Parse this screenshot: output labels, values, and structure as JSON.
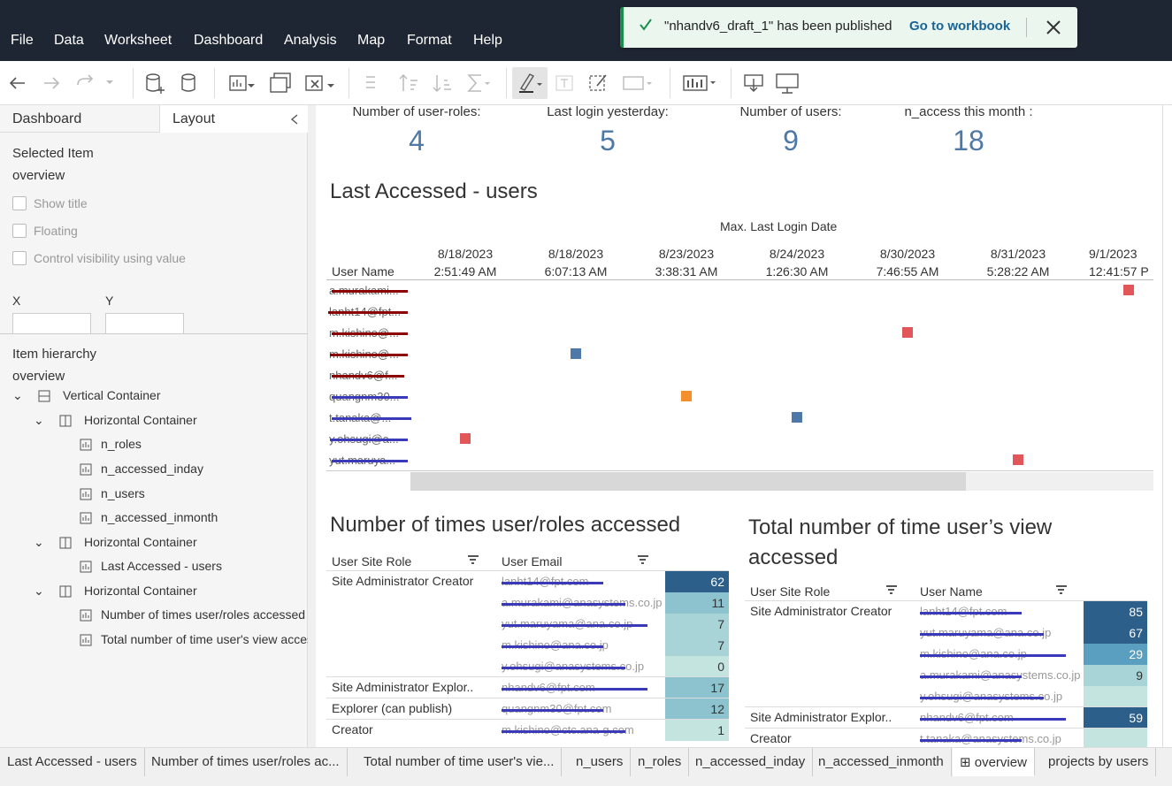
{
  "menu": [
    "File",
    "Data",
    "Worksheet",
    "Dashboard",
    "Analysis",
    "Map",
    "Format",
    "Help"
  ],
  "toast": {
    "message": "\"nhandv6_draft_1\" has been published",
    "link": "Go to workbook"
  },
  "left_pane": {
    "tabs": [
      "Dashboard",
      "Layout"
    ],
    "selected_item_label": "Selected Item",
    "selected_item": "overview",
    "options": [
      "Show title",
      "Floating",
      "Control visibility using value"
    ],
    "x_label": "X",
    "y_label": "Y",
    "hierarchy_label": "Item hierarchy",
    "hierarchy_root": "overview",
    "hierarchy": [
      "Vertical Container",
      "Horizontal Container",
      "n_roles",
      "n_accessed_inday",
      "n_users",
      "n_accessed_inmonth",
      "Horizontal Container",
      "Last Accessed - users",
      "Horizontal Container",
      "Number of times user/roles accessed",
      "Total number of time user's view accessed"
    ]
  },
  "kpis": [
    {
      "label": "Number of user-roles:",
      "value": "4"
    },
    {
      "label": "Last login yesterday:",
      "value": "5"
    },
    {
      "label": "Number of users:",
      "value": "9"
    },
    {
      "label": "n_access this month :",
      "value": "18"
    }
  ],
  "chart1": {
    "title": "Last Accessed - users",
    "header": "Max. Last Login Date",
    "row_header": "User Name",
    "columns": [
      [
        "8/18/2023",
        "2:51:49 AM"
      ],
      [
        "8/18/2023",
        "6:07:13 AM"
      ],
      [
        "8/23/2023",
        "3:38:31 AM"
      ],
      [
        "8/24/2023",
        "1:26:30 AM"
      ],
      [
        "8/30/2023",
        "7:46:55 AM"
      ],
      [
        "8/31/2023",
        "5:28:22 AM"
      ],
      [
        "9/1/2023",
        "12:41:57 P"
      ]
    ],
    "rows": [
      "a.murakami...",
      "lanht14@fpt...",
      "m.kishino@...",
      "m.kishino@...",
      "nhandv6@f...",
      "quangnm30...",
      "t.tanaka@...",
      "y.ohsugi@a...",
      "yut.maruya..."
    ],
    "colors": {
      "red": "#e15759",
      "blue": "#4e79a7",
      "orange": "#f28e2b"
    }
  },
  "chart_data": {
    "type": "scatter",
    "title": "Last Accessed - users",
    "xlabel": "Max. Last Login Date",
    "ylabel": "User Name",
    "points": [
      {
        "user_row": 0,
        "date_col": 6,
        "color": "red"
      },
      {
        "user_row": 2,
        "date_col": 4,
        "color": "red"
      },
      {
        "user_row": 3,
        "date_col": 1,
        "color": "blue"
      },
      {
        "user_row": 5,
        "date_col": 2,
        "color": "orange"
      },
      {
        "user_row": 6,
        "date_col": 3,
        "color": "blue"
      },
      {
        "user_row": 7,
        "date_col": 0,
        "color": "red"
      },
      {
        "user_row": 8,
        "date_col": 5,
        "color": "red"
      }
    ]
  },
  "table1": {
    "title": "Number of times user/roles accessed",
    "col1": "User Site Role",
    "col2": "User Email",
    "rows": [
      {
        "role": "Site Administrator Creator",
        "email": "lanht14@fpt.com",
        "value": "62"
      },
      {
        "role": "",
        "email": "a.murakami@anasystems.co.jp",
        "value": "11"
      },
      {
        "role": "",
        "email": "yut.maruyama@ana.co.jp",
        "value": "7"
      },
      {
        "role": "",
        "email": "m.kishino@ana.co.jp",
        "value": "7"
      },
      {
        "role": "",
        "email": "y.ohsugi@anasystems.co.jp",
        "value": "0"
      },
      {
        "role": "Site Administrator Explor..",
        "email": "nhandv6@fpt.com",
        "value": "17"
      },
      {
        "role": "Explorer (can publish)",
        "email": "quangnm30@fpt.com",
        "value": "12"
      },
      {
        "role": "Creator",
        "email": "m.kishino@ctc.ana-g.com",
        "value": "1"
      }
    ]
  },
  "table2": {
    "title_line1": "Total number of time user’s view",
    "title_line2": "accessed",
    "col1": "User Site Role",
    "col2": "User Name",
    "rows": [
      {
        "role": "Site Administrator Creator",
        "email": "lanht14@fpt.com",
        "value": "85"
      },
      {
        "role": "",
        "email": "yut.maruyama@ana.co.jp",
        "value": "67"
      },
      {
        "role": "",
        "email": "m.kishino@ana.co.jp",
        "value": "29"
      },
      {
        "role": "",
        "email": "a.murakami@anasystems.co.jp",
        "value": "9"
      },
      {
        "role": "",
        "email": "y.ohsugi@anasystems.co.jp",
        "value": ""
      },
      {
        "role": "Site Administrator Explor..",
        "email": "nhandv6@fpt.com",
        "value": "59"
      },
      {
        "role": "Creator",
        "email": "t.tanaka@anasystems.co.jp",
        "value": ""
      }
    ]
  },
  "bottom_tabs": [
    "Last Accessed - users",
    "Number of times user/roles ac...",
    "Total number of time user's vie...",
    "n_users",
    "n_roles",
    "n_accessed_inday",
    "n_accessed_inmonth",
    "overview",
    "projects by users"
  ],
  "active_tab": "overview"
}
